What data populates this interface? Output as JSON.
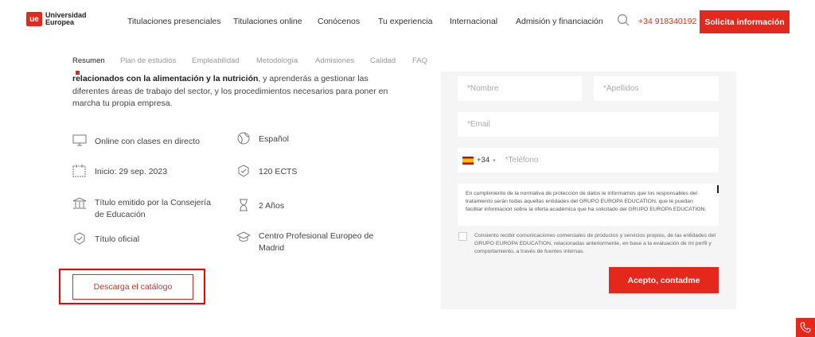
{
  "header": {
    "logo_mark": "ue",
    "logo_line1": "Universidad",
    "logo_line2": "Europea",
    "nav": [
      {
        "label": "Titulaciones presenciales"
      },
      {
        "label": "Titulaciones online"
      },
      {
        "label": "Conócenos"
      },
      {
        "label": "Tu experiencia"
      },
      {
        "label": "Internacional"
      },
      {
        "label": "Admisión y financiación"
      }
    ],
    "phone": "+34 918340192",
    "cta_label": "Solicita información"
  },
  "subnav": {
    "tabs": [
      "Resumen",
      "Plan de estudios",
      "Empleabilidad",
      "Metodología",
      "Admisiones",
      "Calidad",
      "FAQ"
    ],
    "active": "Resumen"
  },
  "description": {
    "bold": "relacionados con la alimentación y la nutrición",
    "rest": ", y aprenderás a gestionar las diferentes áreas de trabajo del sector, y los procedimientos necesarios para poner en marcha tu propia empresa."
  },
  "features": [
    {
      "icon": "monitor-icon",
      "text": "Online con clases en directo"
    },
    {
      "icon": "globe-icon",
      "text": "Español"
    },
    {
      "icon": "calendar-icon",
      "text": "Inicio: 29 sep. 2023"
    },
    {
      "icon": "badge-check-icon",
      "text": "120 ECTS"
    },
    {
      "icon": "institution-icon",
      "text": "Título emitido por la Consejería de Educación"
    },
    {
      "icon": "hourglass-icon",
      "text": "2 Años"
    },
    {
      "icon": "badge-check-icon",
      "text": "Título oficial"
    },
    {
      "icon": "graduation-cap-icon",
      "text": "Centro Profesional Europeo de Madrid"
    }
  ],
  "catalog_button": "Descarga el catálogo",
  "form": {
    "name_placeholder": "*Nombre",
    "surname_placeholder": "*Apellidos",
    "email_placeholder": "*Email",
    "country_code": "+34",
    "phone_placeholder": "*Teléfono",
    "legal_text": "En cumplimiento de la normativa de protección de datos le informamos que los responsables del tratamiento serán todas aquellas entidades del GRUPO EUROPA EDUCATION, que le puedan facilitar información sobre la oferta académica que ha solicitado del GRUPO EUROPA EDUCATION.",
    "consent_text": "Consiento recibir comunicaciones comerciales de productos y servicios propios, de las entidades del GRUPO EUROPA EDUCATION, relacionadas anteriormente, en base a la evaluación de mi perfil y comportamiento, a través de fuentes internas.",
    "submit_label": "Acepto, contadme"
  },
  "colors": {
    "accent": "#e4281b"
  }
}
